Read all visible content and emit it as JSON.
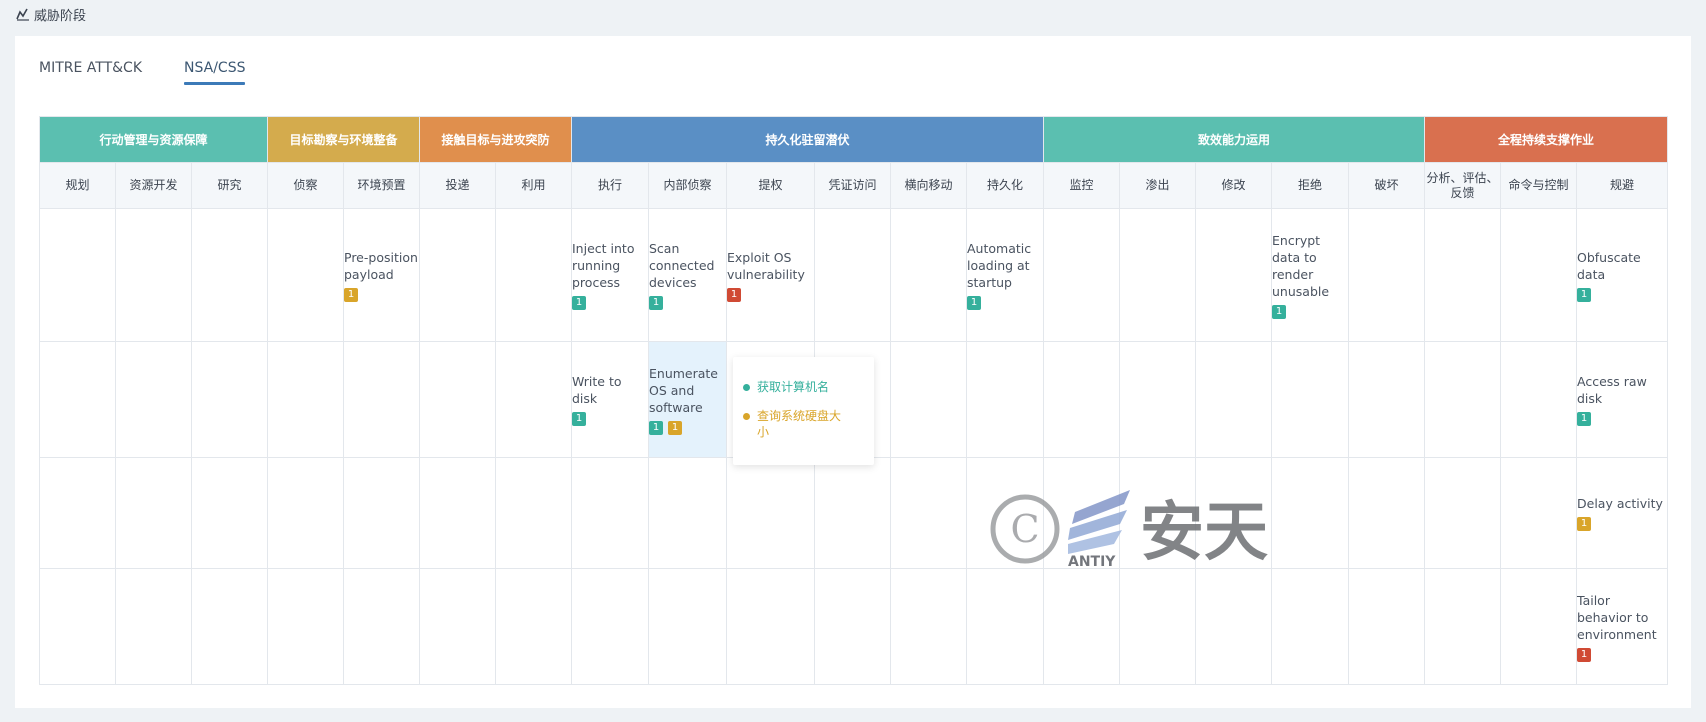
{
  "header": {
    "title": "威胁阶段"
  },
  "tabs": [
    {
      "label": "MITRE ATT&CK",
      "active": false
    },
    {
      "label": "NSA/CSS",
      "active": true
    }
  ],
  "phases": [
    {
      "label": "行动管理与资源保障",
      "color": "#5bbfb0"
    },
    {
      "label": "目标勘察与环境整备",
      "color": "#d4ab4d"
    },
    {
      "label": "接触目标与进攻突防",
      "color": "#e08f4d"
    },
    {
      "label": "持久化驻留潜伏",
      "color": "#5a8fc5"
    },
    {
      "label": "致效能力运用",
      "color": "#5bbfb0"
    },
    {
      "label": "全程持续支撑作业",
      "color": "#d9704f"
    }
  ],
  "tactics": [
    "规划",
    "资源开发",
    "研究",
    "侦察",
    "环境预置",
    "投递",
    "利用",
    "执行",
    "内部侦察",
    "提权",
    "凭证访问",
    "横向移动",
    "持久化",
    "监控",
    "渗出",
    "修改",
    "拒绝",
    "破坏",
    "分析、评估、反馈",
    "命令与控制",
    "规避"
  ],
  "techniques": {
    "r0": {
      "c4": {
        "name": "Pre-position payload",
        "badges": [
          {
            "n": "1",
            "c": "b-yellow"
          }
        ]
      },
      "c7": {
        "name": "Inject into running process",
        "badges": [
          {
            "n": "1",
            "c": "b-teal"
          }
        ]
      },
      "c8": {
        "name": "Scan connected devices",
        "badges": [
          {
            "n": "1",
            "c": "b-teal"
          }
        ]
      },
      "c9": {
        "name": "Exploit OS vulnerability",
        "badges": [
          {
            "n": "1",
            "c": "b-red"
          }
        ]
      },
      "c12": {
        "name": "Automatic loading at startup",
        "badges": [
          {
            "n": "1",
            "c": "b-teal"
          }
        ]
      },
      "c16": {
        "name": "Encrypt data to render unusable",
        "badges": [
          {
            "n": "1",
            "c": "b-teal"
          }
        ]
      },
      "c20": {
        "name": "Obfuscate data",
        "badges": [
          {
            "n": "1",
            "c": "b-teal"
          }
        ]
      }
    },
    "r1": {
      "c7": {
        "name": "Write to disk",
        "badges": [
          {
            "n": "1",
            "c": "b-teal"
          }
        ]
      },
      "c8": {
        "name": "Enumerate OS and software",
        "badges": [
          {
            "n": "1",
            "c": "b-teal"
          },
          {
            "n": "1",
            "c": "b-yellow"
          }
        ]
      },
      "c20": {
        "name": "Access raw disk",
        "badges": [
          {
            "n": "1",
            "c": "b-teal"
          }
        ]
      }
    },
    "r2": {
      "c20": {
        "name": "Delay activity",
        "badges": [
          {
            "n": "1",
            "c": "b-yellow"
          }
        ]
      }
    },
    "r3": {
      "c20": {
        "name": "Tailor behavior to environment",
        "badges": [
          {
            "n": "1",
            "c": "b-red"
          }
        ]
      }
    }
  },
  "popup": {
    "items": [
      {
        "label": "获取计算机名",
        "color": "#35b09c"
      },
      {
        "label": "查询系统硬盘大小",
        "color": "#d9a52a"
      }
    ]
  },
  "watermark": {
    "brand": "ANTIY",
    "name": "安天"
  }
}
